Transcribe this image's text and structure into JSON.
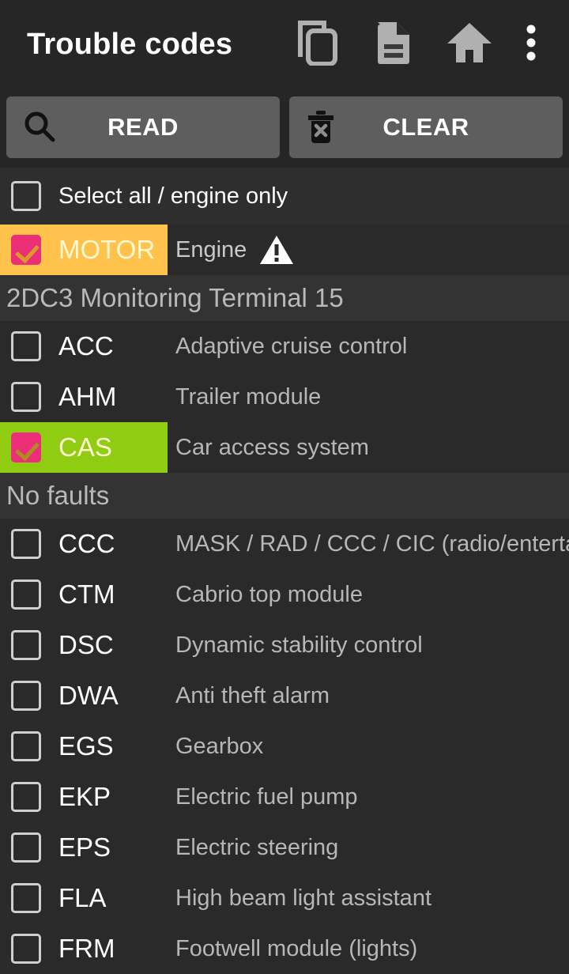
{
  "header": {
    "title": "Trouble codes",
    "icons": [
      {
        "name": "copy-icon",
        "label": "Copy"
      },
      {
        "name": "document-icon",
        "label": "Report"
      },
      {
        "name": "home-icon",
        "label": "Home"
      },
      {
        "name": "overflow-menu-icon",
        "label": "More options"
      }
    ]
  },
  "toolbar": {
    "read_label": "READ",
    "read_icon": "search-icon",
    "clear_label": "CLEAR",
    "clear_icon": "trash-delete-icon"
  },
  "select_all": {
    "label": "Select all / engine only",
    "checked": false
  },
  "colors": {
    "background": "#2a2a2a",
    "appbar": "#262626",
    "button": "#5e5e5e",
    "highlight_amber": "#ffc24d",
    "highlight_green": "#8fcc12",
    "checkbox_checked": "#ec2e79",
    "status_row": "#333333",
    "description_text": "#b7b7b7"
  },
  "list": [
    {
      "kind": "module",
      "abbr": "MOTOR",
      "description": "Engine",
      "checked": true,
      "highlight": "amber",
      "warning": true
    },
    {
      "kind": "status",
      "text": "2DC3 Monitoring Terminal 15"
    },
    {
      "kind": "module",
      "abbr": "ACC",
      "description": "Adaptive cruise control",
      "checked": false,
      "highlight": "none",
      "warning": false
    },
    {
      "kind": "module",
      "abbr": "AHM",
      "description": "Trailer module",
      "checked": false,
      "highlight": "none",
      "warning": false
    },
    {
      "kind": "module",
      "abbr": "CAS",
      "description": "Car access system",
      "checked": true,
      "highlight": "green",
      "warning": false
    },
    {
      "kind": "status",
      "text": "No faults"
    },
    {
      "kind": "module",
      "abbr": "CCC",
      "description": "MASK / RAD / CCC / CIC (radio/entertainment)",
      "checked": false,
      "highlight": "none",
      "warning": false
    },
    {
      "kind": "module",
      "abbr": "CTM",
      "description": "Cabrio top module",
      "checked": false,
      "highlight": "none",
      "warning": false
    },
    {
      "kind": "module",
      "abbr": "DSC",
      "description": "Dynamic stability control",
      "checked": false,
      "highlight": "none",
      "warning": false
    },
    {
      "kind": "module",
      "abbr": "DWA",
      "description": "Anti theft alarm",
      "checked": false,
      "highlight": "none",
      "warning": false
    },
    {
      "kind": "module",
      "abbr": "EGS",
      "description": "Gearbox",
      "checked": false,
      "highlight": "none",
      "warning": false
    },
    {
      "kind": "module",
      "abbr": "EKP",
      "description": "Electric fuel pump",
      "checked": false,
      "highlight": "none",
      "warning": false
    },
    {
      "kind": "module",
      "abbr": "EPS",
      "description": "Electric steering",
      "checked": false,
      "highlight": "none",
      "warning": false
    },
    {
      "kind": "module",
      "abbr": "FLA",
      "description": "High beam light assistant",
      "checked": false,
      "highlight": "none",
      "warning": false
    },
    {
      "kind": "module",
      "abbr": "FRM",
      "description": "Footwell module (lights)",
      "checked": false,
      "highlight": "none",
      "warning": false
    }
  ]
}
